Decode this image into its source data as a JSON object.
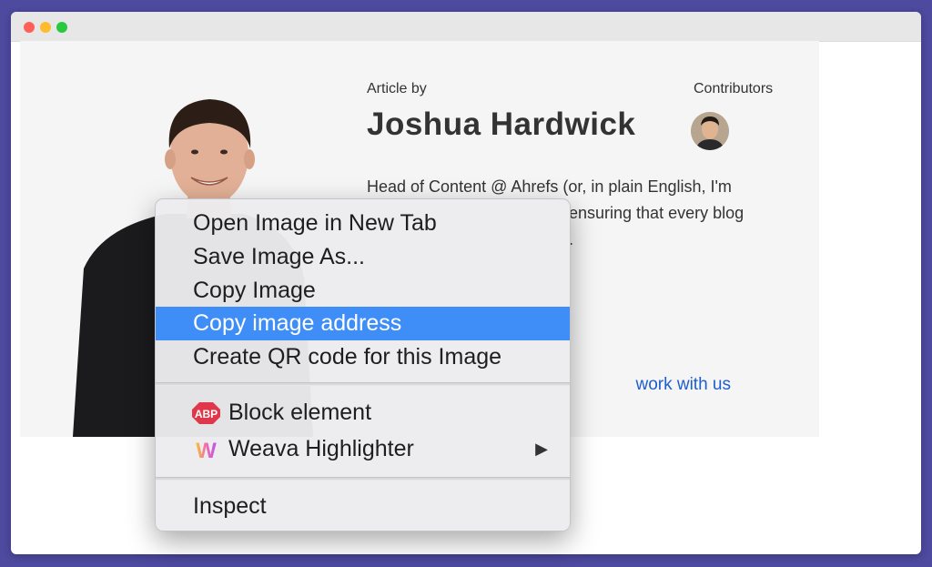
{
  "article": {
    "article_by_label": "Article by",
    "author_name": "Joshua Hardwick",
    "contributors_label": "Contributors",
    "bio_lines": [
      "Head of Content @ Ahrefs (or, in plain English, I'm",
      "ensuring that every blog",
      "."
    ],
    "link_text": "work with us"
  },
  "context_menu": {
    "items": [
      {
        "label": "Open Image in New Tab"
      },
      {
        "label": "Save Image As..."
      },
      {
        "label": "Copy Image"
      },
      {
        "label": "Copy image address",
        "highlighted": true
      },
      {
        "label": "Create QR code for this Image"
      }
    ],
    "extension_items": [
      {
        "label": "Block element",
        "icon": "adblock-plus-icon",
        "icon_text": "ABP"
      },
      {
        "label": "Weava Highlighter",
        "icon": "weava-icon",
        "icon_text": "W",
        "submenu": true
      }
    ],
    "bottom_items": [
      {
        "label": "Inspect"
      }
    ],
    "highlight_color": "#3f8ef8"
  },
  "colors": {
    "frame_background": "#4d4a9f",
    "link": "#1f5ecf",
    "abp_red": "#e0384a"
  }
}
